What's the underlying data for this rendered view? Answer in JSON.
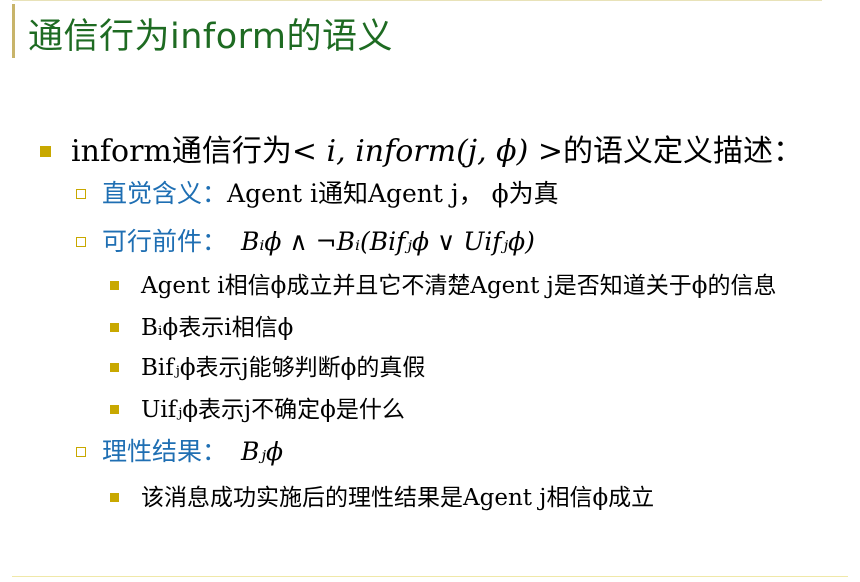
{
  "title": "通信行为inform的语义",
  "main_bullet": {
    "prefix": "inform通信行为",
    "act": "< i, inform(j, ϕ) >",
    "suffix": "的语义定义描述："
  },
  "intuitive": {
    "label": "直觉含义：",
    "text": "Agent i通知Agent j， ϕ为真"
  },
  "feasibility": {
    "label": "可行前件：",
    "formula": "Bᵢϕ ∧ ¬Bᵢ(Bifⱼϕ ∨ Uifⱼϕ)",
    "items": [
      "Agent i相信ϕ成立并且它不清楚Agent j是否知道关于ϕ的信息",
      "Bᵢϕ表示i相信ϕ",
      "Bifⱼϕ表示j能够判断ϕ的真假",
      "Uifⱼϕ表示j不确定ϕ是什么"
    ]
  },
  "rational_effect": {
    "label": "理性结果：",
    "formula": "Bⱼϕ",
    "items": [
      "该消息成功实施后的理性结果是Agent j相信ϕ成立"
    ]
  },
  "colors": {
    "title": "#1e6b22",
    "label_blue": "#1f6fb3",
    "bullet": "#c8a800"
  }
}
